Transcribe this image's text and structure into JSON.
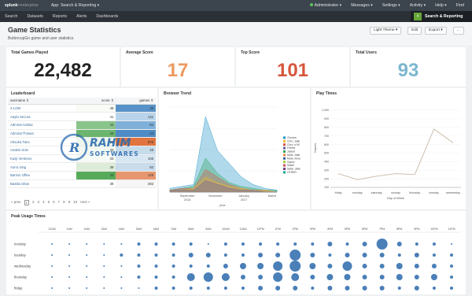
{
  "topbar": {
    "logo_main": "splunk",
    "logo_sub": ">enterprise",
    "app_menu": "App: Search & Reporting ▾",
    "user": "Administrator ▾",
    "messages": "Messages ▾",
    "settings": "Settings ▾",
    "activity": "Activity ▾",
    "help": "Help ▾",
    "find": "Find"
  },
  "appbar": {
    "nav": [
      "Search",
      "Datasets",
      "Reports",
      "Alerts",
      "Dashboards"
    ],
    "brand": "Search & Reporting"
  },
  "header": {
    "title": "Game Statistics",
    "description": "ButtercupGo game and user statistics",
    "theme_button": "Light Theme ▾",
    "edit_button": "Edit",
    "export_button": "Export ▾",
    "more_button": "..."
  },
  "kpis": [
    {
      "label": "Total Games Played",
      "value": "22,482",
      "color": "#222222"
    },
    {
      "label": "Average Score",
      "value": "17",
      "color": "#ec9960"
    },
    {
      "label": "Top Score",
      "value": "101",
      "color": "#d6563c"
    },
    {
      "label": "Total Users",
      "value": "93",
      "color": "#7db7cf"
    }
  ],
  "leaderboard": {
    "title": "Leaderboard",
    "columns": [
      "username ⇕",
      "score ⇕",
      "games ⇕"
    ],
    "rows": [
      {
        "user": "4-LOM",
        "score": "48",
        "games": "39",
        "score_color": "#f8fbf6",
        "games_color": "#5792c9"
      },
      {
        "user": "Aayla Secura",
        "score": "41",
        "games": "141",
        "score_color": "#ffffff",
        "games_color": "#b9d4ea"
      },
      {
        "user": "Admiral Ackbar",
        "score": "44",
        "games": "84",
        "score_color": "#89c48a",
        "games_color": "#7fb0da"
      },
      {
        "user": "Admiral Thrawn",
        "score": "43",
        "games": "44",
        "score_color": "#6bb56e",
        "games_color": "#4f8bc4"
      },
      {
        "user": "Ahsoka Tano",
        "score": "22",
        "games": "878",
        "score_color": "#eef6ed",
        "games_color": "#e1743f"
      },
      {
        "user": "Anakin Solo",
        "score": "33",
        "games": "48",
        "score_color": "#f2f8f1",
        "games_color": "#c7dceb"
      },
      {
        "user": "Kazji Ventress",
        "score": "33",
        "games": "108",
        "score_color": "#f6faf5",
        "games_color": "#d6e6f2"
      },
      {
        "user": "Aurra Sing",
        "score": "39",
        "games": "82",
        "score_color": "#dcecd9",
        "games_color": "#c8dcec"
      },
      {
        "user": "Barriss Offee",
        "score": "43",
        "games": "128",
        "score_color": "#56aa59",
        "games_color": "#e79770"
      },
      {
        "user": "Bastila Shan",
        "score": "39",
        "games": "282",
        "score_color": "#ffffff",
        "games_color": "#f6f6f6"
      }
    ],
    "pager": [
      "« prev",
      "1",
      "2",
      "3",
      "4",
      "5",
      "6",
      "7",
      "8",
      "9",
      "10",
      "next »"
    ]
  },
  "browser_trend": {
    "title": "Browser Trend",
    "x_ticks": [
      "September\n2016",
      "November",
      "January\n2017",
      "March"
    ],
    "xlabel": "_time",
    "legend": [
      "Chrome",
      "Chro..Jalle",
      "Chro..e 60",
      "Firefox",
      "Jaseal",
      "Mobi..Jalle",
      "Mobi..rfone",
      "Opera",
      "Safari",
      "Safar..Jalle",
      "OTHER"
    ],
    "legend_colors": [
      "#1e93c6",
      "#f2b827",
      "#d6563c",
      "#6a5c9e",
      "#31a35f",
      "#ed8440",
      "#3863a0",
      "#a2cc3e",
      "#cc5068",
      "#73427f",
      "#11a88b"
    ],
    "x_range": [
      "2016-08-01",
      "2017-03-15"
    ],
    "series_data": [
      {
        "color": "#1e93c6",
        "values": [
          2,
          3,
          4,
          40,
          22,
          15,
          8,
          4,
          2,
          1
        ]
      },
      {
        "color": "#31a35f",
        "values": [
          1,
          2,
          3,
          18,
          10,
          5,
          3,
          2,
          1,
          1
        ]
      },
      {
        "color": "#d6563c",
        "values": [
          1,
          2,
          2,
          12,
          8,
          4,
          2,
          1,
          1,
          0
        ]
      },
      {
        "color": "#f2b827",
        "values": [
          1,
          1,
          2,
          8,
          5,
          3,
          2,
          1,
          1,
          0
        ]
      },
      {
        "color": "#6a5c9e",
        "values": [
          1,
          1,
          1,
          6,
          4,
          2,
          1,
          1,
          0,
          0
        ]
      }
    ]
  },
  "play_times": {
    "title": "Play Times",
    "ylabel": "Games",
    "xlabel": "Day of Week",
    "y_ticks": [
      "1,000",
      "900",
      "800",
      "700",
      "600",
      "500",
      "400",
      "300",
      "200",
      "100"
    ],
    "y_min": 100,
    "y_max": 1000,
    "days": [
      "friday",
      "monday",
      "saturday",
      "sunday",
      "thursday",
      "tuesday",
      "wednesday"
    ],
    "values": [
      260,
      190,
      230,
      260,
      250,
      780,
      620
    ]
  },
  "peak_usage": {
    "title": "Peak Usage Times",
    "hours": [
      "12AM",
      "1AM",
      "2AM",
      "3AM",
      "4AM",
      "5AM",
      "6AM",
      "7AM",
      "8AM",
      "9AM",
      "10AM",
      "11AM",
      "12PM",
      "1PM",
      "2PM",
      "3PM",
      "4PM",
      "5PM",
      "6PM",
      "7PM",
      "8PM",
      "9PM",
      "10PM",
      "11PM"
    ],
    "days": [
      "monday",
      "tuesday",
      "wednesday",
      "thursday",
      "friday"
    ],
    "values": [
      [
        1,
        1,
        1,
        1,
        1,
        2,
        2,
        2,
        2,
        1,
        2,
        2,
        2,
        2,
        2,
        2,
        3,
        2,
        3,
        7,
        3,
        2,
        2,
        1
      ],
      [
        1,
        1,
        1,
        1,
        2,
        2,
        2,
        2,
        3,
        3,
        2,
        2,
        3,
        3,
        7,
        3,
        2,
        3,
        3,
        3,
        2,
        3,
        2,
        2
      ],
      [
        1,
        1,
        1,
        1,
        1,
        2,
        2,
        2,
        2,
        2,
        3,
        4,
        4,
        6,
        7,
        4,
        3,
        6,
        3,
        3,
        4,
        3,
        3,
        2
      ],
      [
        1,
        1,
        1,
        1,
        1,
        2,
        2,
        2,
        5,
        6,
        5,
        3,
        3,
        6,
        5,
        3,
        4,
        4,
        3,
        3,
        4,
        3,
        4,
        2
      ],
      [
        1,
        1,
        1,
        1,
        1,
        1,
        2,
        2,
        2,
        2,
        2,
        2,
        3,
        3,
        3,
        2,
        3,
        3,
        3,
        3,
        2,
        3,
        2,
        2
      ]
    ]
  },
  "watermark": {
    "line1": "RAHIM",
    "line2": "SOFTWARES"
  }
}
